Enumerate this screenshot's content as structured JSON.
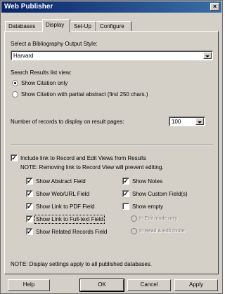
{
  "window": {
    "title": "Web Publisher",
    "close_glyph": "×"
  },
  "tabs": [
    {
      "label": "Databases",
      "active": false
    },
    {
      "label": "Display",
      "active": true
    },
    {
      "label": "Set-Up",
      "active": false
    },
    {
      "label": "Configure",
      "active": false
    }
  ],
  "bibliography": {
    "label": "Select a Bibliography Output Style:",
    "selected": "Harvard"
  },
  "search_results": {
    "label": "Search Results list view:",
    "options": [
      {
        "label": "Show Citation only",
        "selected": true
      },
      {
        "label": "Show Citation with partial abstract (first 250 chars.)",
        "selected": false
      }
    ]
  },
  "records": {
    "label": "Number of records to display on result pages:",
    "selected": "100"
  },
  "include_link": {
    "label": "Include link to Record and Edit Views from Results",
    "checked": true,
    "note": "NOTE: Removing link to Record View will prevent editing."
  },
  "fields_left": [
    {
      "label": "Show Abstract Field",
      "checked": true
    },
    {
      "label": "Show Web/URL Field",
      "checked": true
    },
    {
      "label": "Show Link to PDF Field",
      "checked": true
    },
    {
      "label": "Show Link to Full-text Field",
      "checked": true
    },
    {
      "label": "Show Related Records Field",
      "checked": true
    }
  ],
  "fields_right": [
    {
      "label": "Show Notes",
      "checked": true
    },
    {
      "label": "Show Custom Field(s)",
      "checked": true
    },
    {
      "label": "Show empty",
      "checked": false
    }
  ],
  "empty_modes": [
    {
      "label": "In Edit mode only",
      "selected": true
    },
    {
      "label": "In Read & Edit mode",
      "selected": false
    }
  ],
  "footer_note": "NOTE: Display settings apply to all published databases.",
  "buttons": {
    "help": "Help",
    "ok": "OK",
    "cancel": "Cancel",
    "apply": "Apply"
  },
  "check_glyph": "✓"
}
